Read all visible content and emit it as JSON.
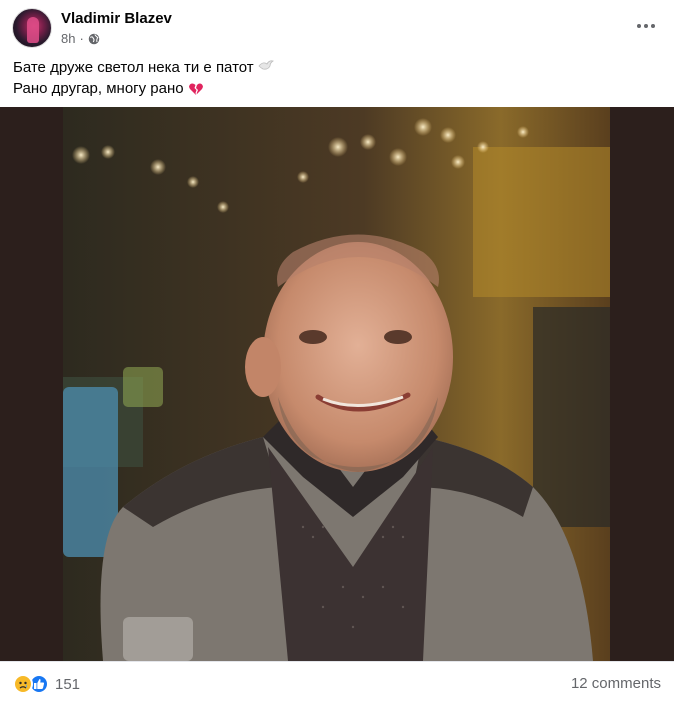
{
  "post": {
    "author": "Vladimir Blazev",
    "time": "8h",
    "audience_icon": "globe-icon",
    "text_lines": [
      "Бате друже светол нека ти е патот",
      "Рано другар, многу рано"
    ],
    "line1_emoji": "dove-icon",
    "line2_emoji": "broken-heart-icon",
    "photo_alt": "photo"
  },
  "footer": {
    "reaction_icons": [
      "sad-reaction-icon",
      "like-reaction-icon"
    ],
    "reaction_count": "151",
    "comments": "12 comments"
  },
  "colors": {
    "like": "#1877f2",
    "sad": "#f7b928",
    "heart": "#e0245e",
    "meta_text": "#65676b"
  }
}
